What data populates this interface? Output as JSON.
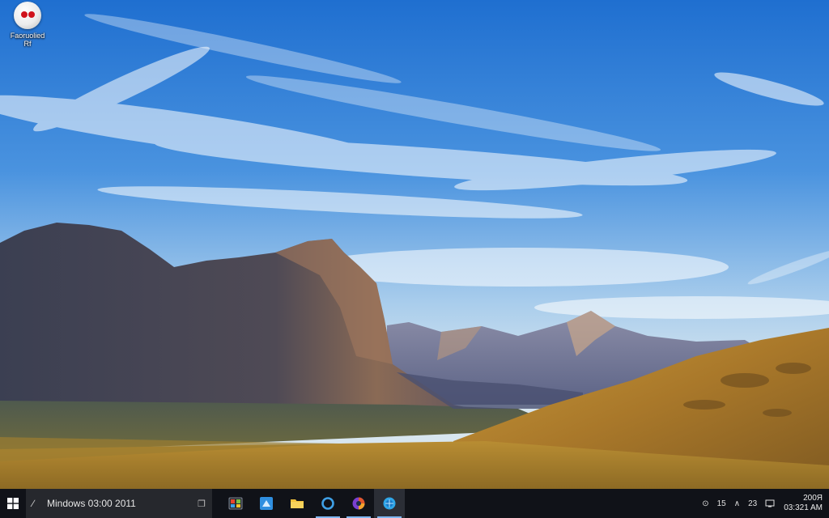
{
  "desktop": {
    "icons": [
      {
        "label": "Faoruolied\nRf"
      }
    ]
  },
  "taskbar": {
    "start_icon": "windows-logo-icon",
    "search": {
      "text": "Mindows 03:00 2011"
    },
    "apps": [
      {
        "icon": "colorful-window-icon",
        "color": "#3aa0e8"
      },
      {
        "icon": "blue-square-app-icon",
        "color": "#2f8fe0"
      },
      {
        "icon": "file-explorer-folder-icon",
        "color": "#f3c23c"
      },
      {
        "icon": "circular-ring-app-icon",
        "color": "#3fa0e6"
      },
      {
        "icon": "browser-orb-icon",
        "color": "#e2572b"
      },
      {
        "icon": "edge-style-globe-icon",
        "color": "#2fa6e8"
      }
    ],
    "tray": {
      "items": [
        "15",
        "23"
      ],
      "clock_time": "200Я",
      "clock_date": "03:321 AM"
    }
  }
}
